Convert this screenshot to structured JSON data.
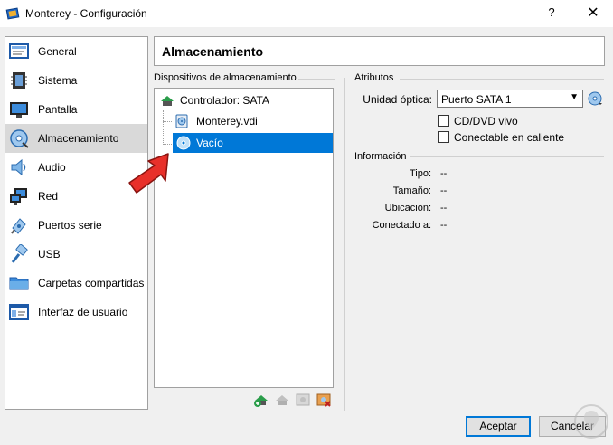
{
  "window": {
    "title": "Monterey - Configuración",
    "help_label": "?",
    "close_label": "✕"
  },
  "sidebar": {
    "items": [
      {
        "label": "General",
        "icon": "general-icon"
      },
      {
        "label": "Sistema",
        "icon": "system-icon"
      },
      {
        "label": "Pantalla",
        "icon": "display-icon"
      },
      {
        "label": "Almacenamiento",
        "icon": "storage-icon",
        "selected": true
      },
      {
        "label": "Audio",
        "icon": "audio-icon"
      },
      {
        "label": "Red",
        "icon": "network-icon"
      },
      {
        "label": "Puertos serie",
        "icon": "serial-ports-icon"
      },
      {
        "label": "USB",
        "icon": "usb-icon"
      },
      {
        "label": "Carpetas compartidas",
        "icon": "shared-folders-icon"
      },
      {
        "label": "Interfaz de usuario",
        "icon": "user-interface-icon"
      }
    ]
  },
  "main": {
    "title": "Almacenamiento",
    "devices_group": "Dispositivos de almacenamiento",
    "tree": {
      "controller": "Controlador: SATA",
      "disk": "Monterey.vdi",
      "optical": "Vacío"
    },
    "attributes_group": "Atributos",
    "optical_drive_label": "Unidad óptica:",
    "optical_drive_value": "Puerto SATA 1",
    "live_cd_label": "CD/DVD vivo",
    "hotplug_label": "Conectable en caliente",
    "info_group": "Información",
    "info": [
      {
        "label": "Tipo:",
        "value": "--"
      },
      {
        "label": "Tamaño:",
        "value": "--"
      },
      {
        "label": "Ubicación:",
        "value": "--"
      },
      {
        "label": "Conectado a:",
        "value": "--"
      }
    ]
  },
  "buttons": {
    "accept": "Aceptar",
    "cancel": "Cancelar"
  },
  "colors": {
    "selection": "#0078d7",
    "sidebar_selected": "#d9d9d9",
    "arrow": "#e8302a"
  }
}
